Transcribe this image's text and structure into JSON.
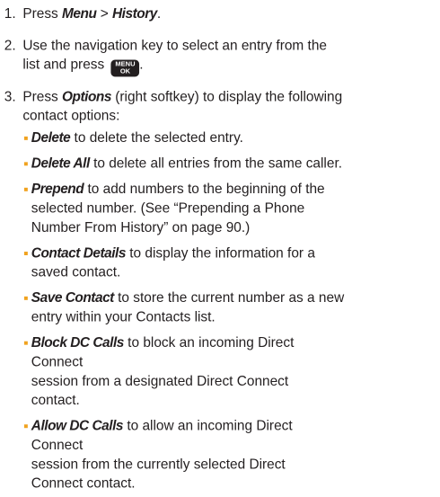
{
  "steps": [
    {
      "number": "1.",
      "pre": "Press ",
      "term1": "Menu",
      "sep": " > ",
      "term2": "History",
      "post": "."
    },
    {
      "number": "2.",
      "line1": "Use the navigation key to select an entry from the",
      "line2_pre": "list and press ",
      "key_top": "MENU",
      "key_bottom": "OK",
      "line2_post": "."
    },
    {
      "number": "3.",
      "pre": "Press ",
      "term": "Options",
      "line1_post": " (right softkey) to display the following",
      "line2": "contact options:"
    }
  ],
  "options": [
    {
      "term": "Delete",
      "lines": [
        " to delete the selected entry."
      ]
    },
    {
      "term": "Delete All",
      "lines": [
        " to delete all entries from the same caller."
      ]
    },
    {
      "term": "Prepend",
      "lines": [
        " to add numbers to the beginning of the",
        "selected number. (See “Prepending a Phone",
        "Number From History” on page 90.)"
      ]
    },
    {
      "term": "Contact Details",
      "lines": [
        " to display the information for a",
        "saved contact."
      ]
    },
    {
      "term": "Save Contact",
      "lines": [
        " to store the current number as a new",
        "entry within your Contacts list."
      ]
    },
    {
      "term": "Block DC Calls",
      "lines": [
        " to block an incoming Direct Connect",
        "session from a designated Direct Connect",
        "contact."
      ]
    },
    {
      "term": "Allow DC Calls",
      "lines": [
        " to allow an incoming Direct Connect",
        "session from the currently selected Direct",
        "Connect contact."
      ]
    }
  ],
  "colors": {
    "text": "#231f20",
    "bullet": "#f0a21f",
    "key_bg": "#231f20",
    "key_fg": "#ffffff"
  }
}
